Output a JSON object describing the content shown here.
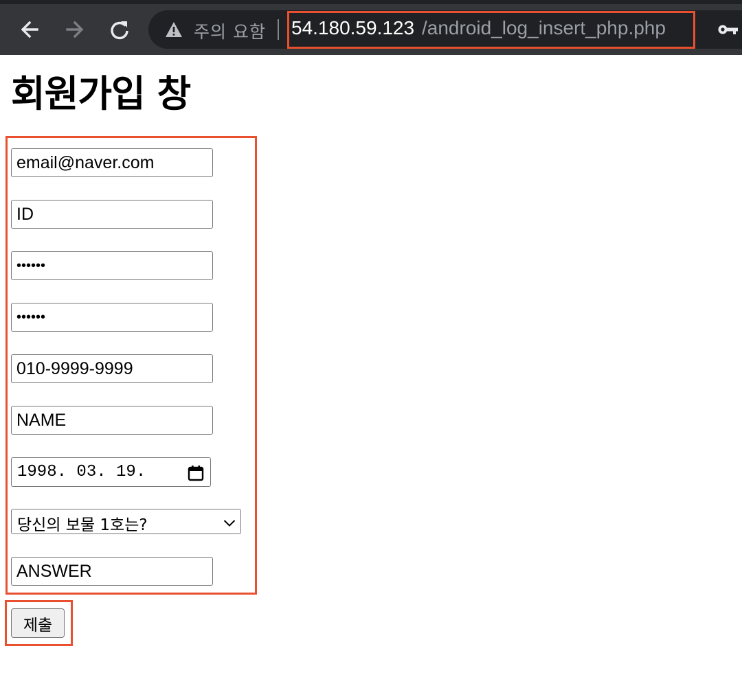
{
  "browser": {
    "security_warning": "주의 요함",
    "url_host": "54.180.59.123",
    "url_path": "/android_log_insert_php.php",
    "icons": [
      "back-arrow-icon",
      "forward-arrow-icon",
      "reload-icon",
      "warning-icon",
      "key-icon"
    ]
  },
  "page": {
    "title": "회원가입 창",
    "form": {
      "email": "email@naver.com",
      "id": "ID",
      "password": "••••••",
      "password_confirm": "••••••",
      "phone": "010-9999-9999",
      "name": "NAME",
      "birthdate": "1998. 03. 19.",
      "question_selected": "당신의 보물 1호는?",
      "answer": "ANSWER"
    },
    "submit_label": "제출"
  },
  "colors": {
    "chrome_bg": "#35363a",
    "omnibox_bg": "#202124",
    "highlight_border": "#e8502f"
  }
}
